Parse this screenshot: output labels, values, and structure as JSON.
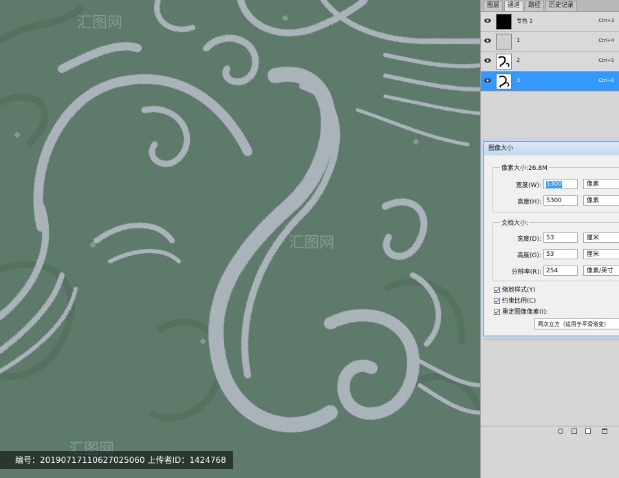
{
  "panel_tabs": [
    "图层",
    "通道",
    "路径",
    "历史记录"
  ],
  "channels": [
    {
      "name": "专色 1",
      "shortcut": "Ctrl+3",
      "thumb": "black"
    },
    {
      "name": "1",
      "shortcut": "Ctrl+4",
      "thumb": "gray"
    },
    {
      "name": "2",
      "shortcut": "Ctrl+5",
      "thumb": "white"
    },
    {
      "name": "3",
      "shortcut": "Ctrl+6",
      "thumb": "white",
      "selected": true
    }
  ],
  "dialog": {
    "title": "图像大小",
    "pixel_group": {
      "label": "像素大小:26.8M",
      "width_label": "宽度(W):",
      "width_value": "5300",
      "width_unit": "像素",
      "height_label": "高度(H):",
      "height_value": "5300",
      "height_unit": "像素"
    },
    "doc_group": {
      "label": "文档大小:",
      "width_label": "宽度(D):",
      "width_value": "53",
      "width_unit": "厘米",
      "height_label": "高度(G):",
      "height_value": "53",
      "height_unit": "厘米",
      "res_label": "分辨率(R):",
      "res_value": "254",
      "res_unit": "像素/英寸"
    },
    "checks": {
      "scale_styles": "缩放样式(Y)",
      "constrain": "约束比例(C)",
      "resample": "重定图像像素(I):"
    },
    "resample_method": "两次立方（适用于平滑渐变）"
  },
  "footer": {
    "text": "编号：20190717110627025060 上传者ID：1424768"
  },
  "colors": {
    "canvas_bg": "#5d7a6b",
    "swirl": "#a9b3b9",
    "selection": "#3399ff"
  }
}
